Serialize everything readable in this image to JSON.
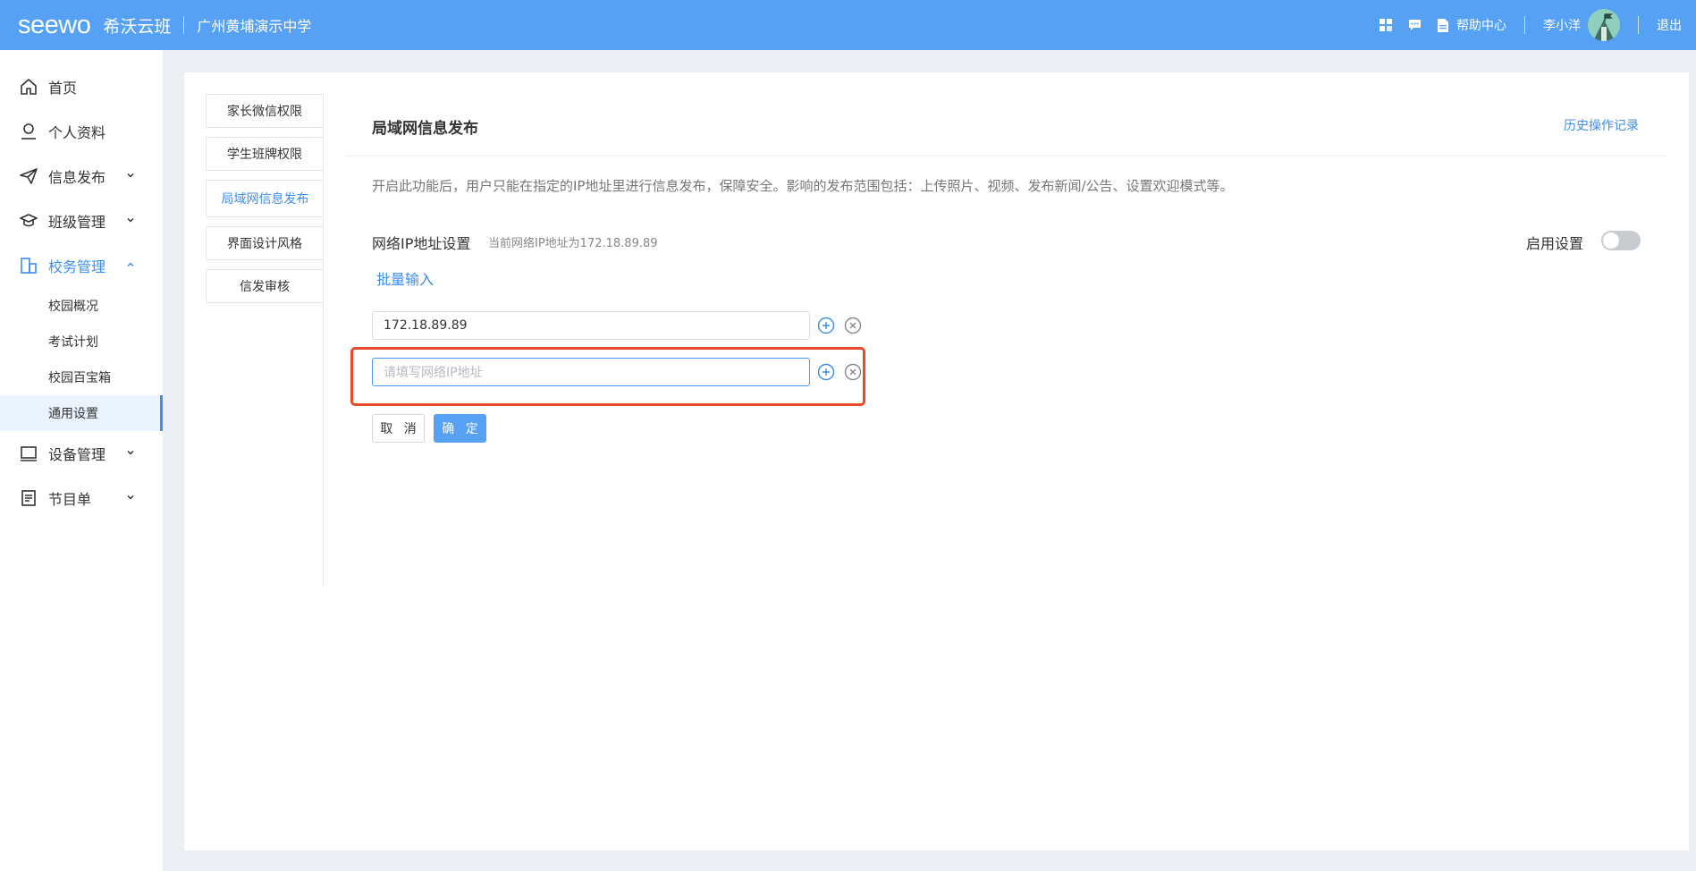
{
  "header": {
    "logo": "seewo",
    "product": "希沃云班",
    "school": "广州黄埔演示中学",
    "help": "帮助中心",
    "user_name": "李小洋",
    "logout": "退出"
  },
  "sidebar": {
    "items": [
      {
        "label": "首页",
        "icon": "home-icon"
      },
      {
        "label": "个人资料",
        "icon": "person-icon"
      },
      {
        "label": "信息发布",
        "icon": "send-icon"
      },
      {
        "label": "班级管理",
        "icon": "graduation-cap-icon"
      },
      {
        "label": "校务管理",
        "icon": "school-icon"
      },
      {
        "label": "设备管理",
        "icon": "monitor-icon"
      },
      {
        "label": "节目单",
        "icon": "list-icon"
      }
    ],
    "sub_items": [
      "校园概况",
      "考试计划",
      "校园百宝箱",
      "通用设置"
    ]
  },
  "tabs": [
    "家长微信权限",
    "学生班牌权限",
    "局域网信息发布",
    "界面设计风格",
    "信发审核"
  ],
  "content": {
    "title": "局域网信息发布",
    "history": "历史操作记录",
    "description": "开启此功能后，用户只能在指定的IP地址里进行信息发布，保障安全。影响的发布范围包括：上传照片、视频、发布新闻/公告、设置欢迎模式等。",
    "ip_setting_label": "网络IP地址设置",
    "ip_current": "当前网络IP地址为172.18.89.89",
    "enable_label": "启用设置",
    "enabled": false,
    "batch_input": "批量输入",
    "ip_values": [
      "172.18.89.89"
    ],
    "ip_placeholder": "请填写网络IP地址",
    "cancel": "取 消",
    "confirm": "确 定"
  },
  "colors": {
    "primary": "#56a1f3",
    "link": "#3c8ef0",
    "highlight": "#e84a2c"
  }
}
